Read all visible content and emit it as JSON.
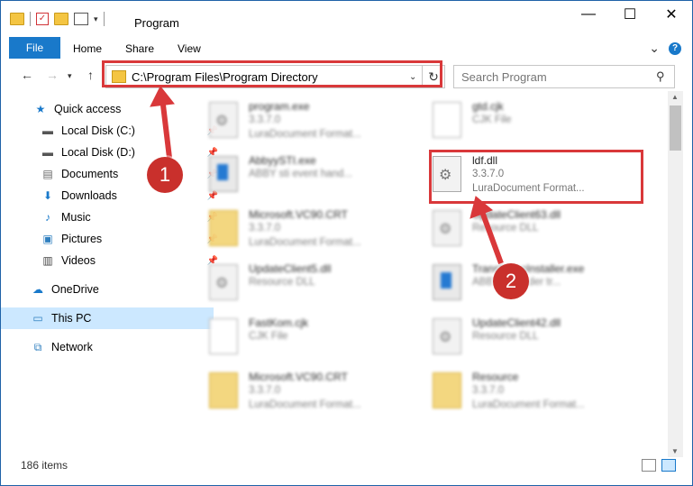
{
  "window": {
    "title": "Program",
    "controls": {
      "minimize": "—",
      "maximize": "☐",
      "close": "✕"
    }
  },
  "ribbon": {
    "file_tab": "File",
    "tabs": [
      "Home",
      "Share",
      "View"
    ],
    "expand": "⌄",
    "help": "?"
  },
  "nav": {
    "back": "←",
    "forward": "→",
    "up": "↑",
    "address": "C:\\Program Files\\Program Directory",
    "address_dropdown": "⌄",
    "refresh": "↻",
    "search_placeholder": "Search Program",
    "search_icon": "⚲"
  },
  "sidebar": {
    "items": [
      {
        "label": "Quick access",
        "icon": "star-icon",
        "pinned": false
      },
      {
        "label": "Local Disk (C:)",
        "icon": "drive-icon",
        "pinned": true
      },
      {
        "label": "Local Disk (D:)",
        "icon": "drive-icon",
        "pinned": true
      },
      {
        "label": "Documents",
        "icon": "documents-icon",
        "pinned": true
      },
      {
        "label": "Downloads",
        "icon": "download-icon",
        "pinned": true
      },
      {
        "label": "Music",
        "icon": "music-icon",
        "pinned": true
      },
      {
        "label": "Pictures",
        "icon": "pictures-icon",
        "pinned": true
      },
      {
        "label": "Videos",
        "icon": "videos-icon",
        "pinned": true
      },
      {
        "label": "OneDrive",
        "icon": "cloud-icon",
        "pinned": false
      },
      {
        "label": "This PC",
        "icon": "pc-icon",
        "pinned": false,
        "selected": true
      },
      {
        "label": "Network",
        "icon": "network-icon",
        "pinned": false
      }
    ],
    "pin_glyph": "📌"
  },
  "files": [
    {
      "name": "program.exe",
      "line2": "3.3.7.0",
      "line3": "LuraDocument Format...",
      "type": "dll"
    },
    {
      "name": "gtd.cjk",
      "line2": "CJK File",
      "line3": "",
      "type": "doc"
    },
    {
      "name": "AbbyySTI.exe",
      "line2": "ABBY sti event hand...",
      "line3": "",
      "type": "exe"
    },
    {
      "name": "ldf.dll",
      "line2": "3.3.7.0",
      "line3": "LuraDocument Format...",
      "type": "dll",
      "selected": true
    },
    {
      "name": "Microsoft.VC90.CRT",
      "line2": "3.3.7.0",
      "line3": "LuraDocument Format...",
      "type": "fold"
    },
    {
      "name": "UpdateClient63.dll",
      "line2": "Resource DLL",
      "line3": "",
      "type": "dll"
    },
    {
      "name": "UpdateClient5.dll",
      "line2": "Resource DLL",
      "line3": "",
      "type": "dll"
    },
    {
      "name": "TransformsInstaller.exe",
      "line2": "ABBYY Reader tr...",
      "line3": "",
      "type": "exe"
    },
    {
      "name": "FastKom.cjk",
      "line2": "CJK File",
      "line3": "",
      "type": "doc"
    },
    {
      "name": "UpdateClient42.dll",
      "line2": "Resource DLL",
      "line3": "",
      "type": "dll"
    },
    {
      "name": "Microsoft.VC90.CRT",
      "line2": "3.3.7.0",
      "line3": "LuraDocument Format...",
      "type": "fold"
    },
    {
      "name": "Resource",
      "line2": "3.3.7.0",
      "line3": "LuraDocument Format...",
      "type": "fold"
    }
  ],
  "status": {
    "items": "186 items"
  },
  "annotations": {
    "step1": "1",
    "step2": "2"
  },
  "colors": {
    "accent": "#1979ca",
    "highlight": "#d9383a",
    "badge": "#c9302c",
    "selected": "#cce8ff"
  }
}
